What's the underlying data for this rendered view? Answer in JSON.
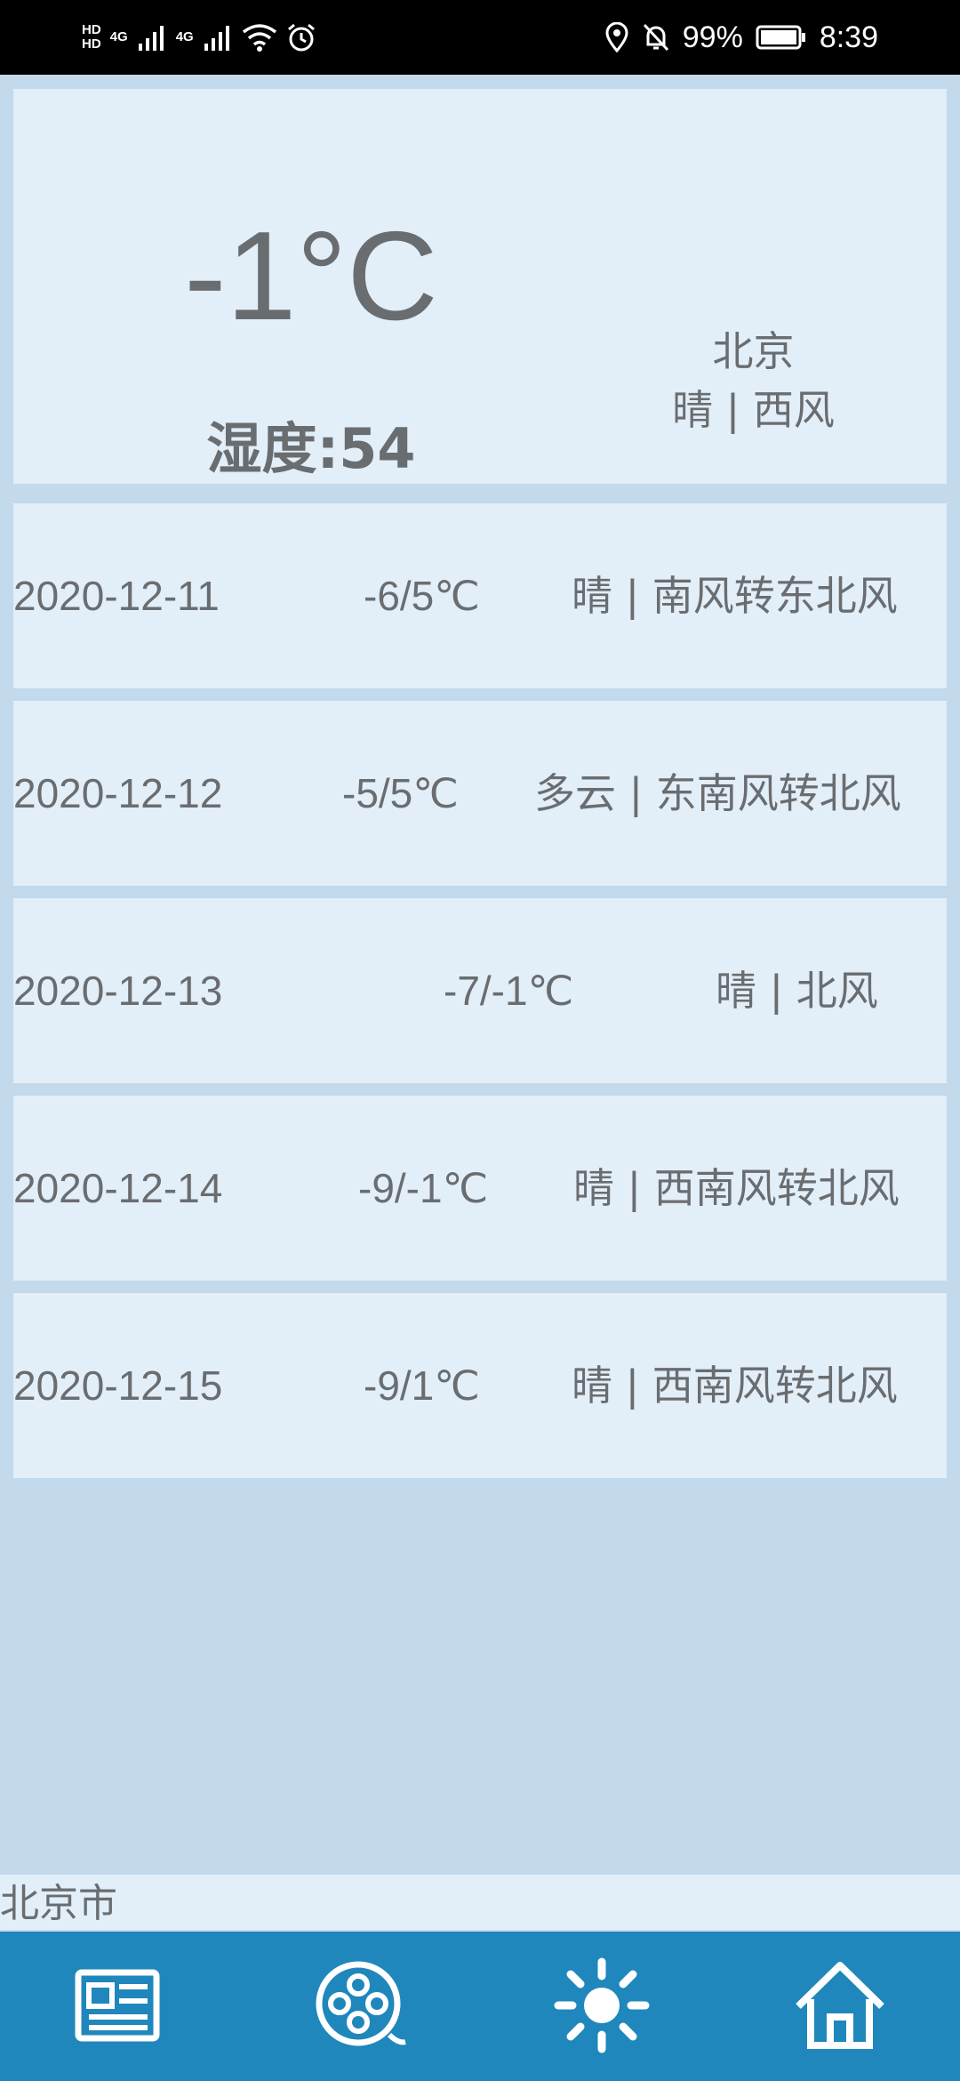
{
  "status_bar": {
    "hd1": "HD",
    "hd2": "HD",
    "sim1_net": "4G",
    "sim2_net": "4G",
    "battery_percent": "99%",
    "time": "8:39",
    "icons": [
      "signal-icon",
      "wifi-icon",
      "alarm-icon",
      "location-icon",
      "mute-icon",
      "battery-icon"
    ]
  },
  "current": {
    "temperature": "-1°C",
    "humidity": "湿度:54",
    "city": "北京",
    "condition": "晴 | 西风"
  },
  "forecast": [
    {
      "date": "2020-12-11",
      "temp": "-6/5℃",
      "desc": "晴 | 南风转东北风"
    },
    {
      "date": "2020-12-12",
      "temp": "-5/5℃",
      "desc": "多云 | 东南风转北风"
    },
    {
      "date": "2020-12-13",
      "temp": "-7/-1℃",
      "desc": "晴 | 北风"
    },
    {
      "date": "2020-12-14",
      "temp": "-9/-1℃",
      "desc": "晴 | 西南风转北风"
    },
    {
      "date": "2020-12-15",
      "temp": "-9/1℃",
      "desc": "晴 | 西南风转北风"
    }
  ],
  "location_label": "北京市",
  "nav": {
    "items": [
      "news-icon",
      "film-reel-icon",
      "sun-icon",
      "home-icon"
    ]
  },
  "colors": {
    "background": "#c3d9ec",
    "card": "#e2eef8",
    "text": "#6a6d70",
    "nav": "#1f87bb",
    "status_bar": "#000000"
  }
}
